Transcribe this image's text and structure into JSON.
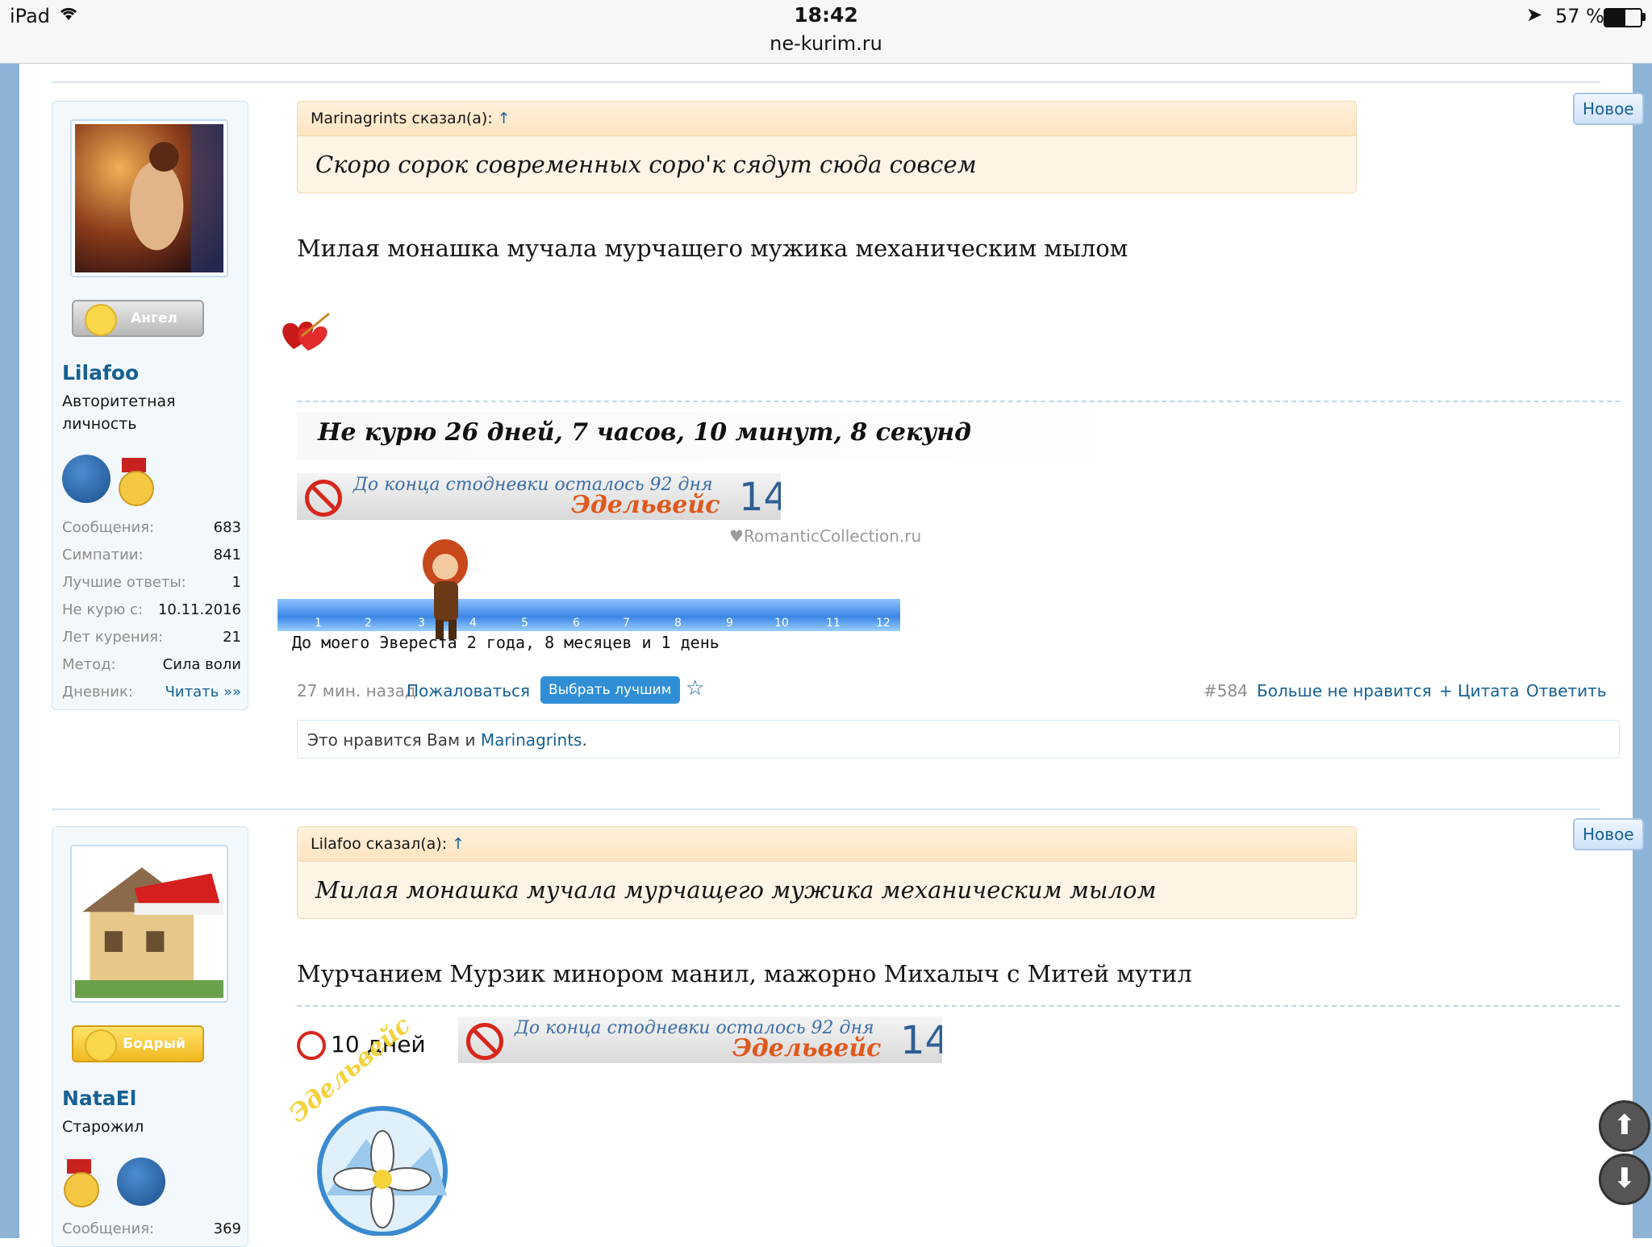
{
  "status_bar": {
    "device": "iPad",
    "time": "18:42",
    "url": "ne-kurim.ru",
    "battery": "57 %",
    "battery_level": 0.57
  },
  "posts": [
    {
      "new_badge": "Новое",
      "user": {
        "rank": "Ангел",
        "name": "Lilafoo",
        "title_line1": "Авторитетная",
        "title_line2": "личность",
        "stats": [
          {
            "label": "Сообщения:",
            "value": "683"
          },
          {
            "label": "Симпатии:",
            "value": "841"
          },
          {
            "label": "Лучшие ответы:",
            "value": "1"
          },
          {
            "label": "Не курю с:",
            "value": "10.11.2016"
          },
          {
            "label": "Лет курения:",
            "value": "21"
          },
          {
            "label": "Метод:",
            "value": "Сила воли"
          },
          {
            "label": "Дневник:",
            "value": "Читать »»"
          }
        ]
      },
      "quote": {
        "author": "Marinagrints сказал(а):",
        "arrow": "↑",
        "text": "Скоро сорок современных соро'к сядут сюда совсем"
      },
      "text": "Милая монашка мучала мурчащего мужика механическим мылом",
      "signature": {
        "no_smoking": "Не курю 26 дней, 7 часов, 10 минут, 8 секунд",
        "counter_text": "До конца стодневки осталось 92 дня",
        "counter_brand": "Эдельвейс",
        "counter_num": "14",
        "romantic": "♥RomanticCollection.ru",
        "ruler_nums": [
          "1",
          "2",
          "3",
          "4",
          "5",
          "6",
          "7",
          "8",
          "9",
          "10",
          "11",
          "12"
        ],
        "everest": "До моего Эвереста 2 года, 8 месяцев и 1 день"
      },
      "meta": {
        "time": "27 мин. назад",
        "report": "Пожаловаться",
        "best": "Выбрать лучшим",
        "star": "☆",
        "num": "#584",
        "unlike": "Больше не нравится",
        "quote": "+ Цитата",
        "reply": "Ответить"
      },
      "likes": {
        "prefix": "Это нравится Вам и ",
        "user": "Marinagrints",
        "suffix": "."
      }
    },
    {
      "new_badge": "Новое",
      "user": {
        "rank": "Бодрый",
        "name": "NataEl",
        "title_line1": "Старожил",
        "stats": [
          {
            "label": "Сообщения:",
            "value": "369"
          }
        ]
      },
      "quote": {
        "author": "Lilafoo сказал(а):",
        "arrow": "↑",
        "text": "Милая монашка мучала мурчащего мужика механическим мылом"
      },
      "text": "Мурчанием Мурзик минором манил, мажорно Михалыч с Митей мутил",
      "signature": {
        "days": "10 дней",
        "counter_text": "До конца стодневки осталось 92 дня",
        "counter_brand": "Эдельвейс",
        "counter_num": "14",
        "logo_text": "Эдельвейс"
      }
    }
  ],
  "scroll": {
    "up": "⬆",
    "down": "⬇"
  }
}
